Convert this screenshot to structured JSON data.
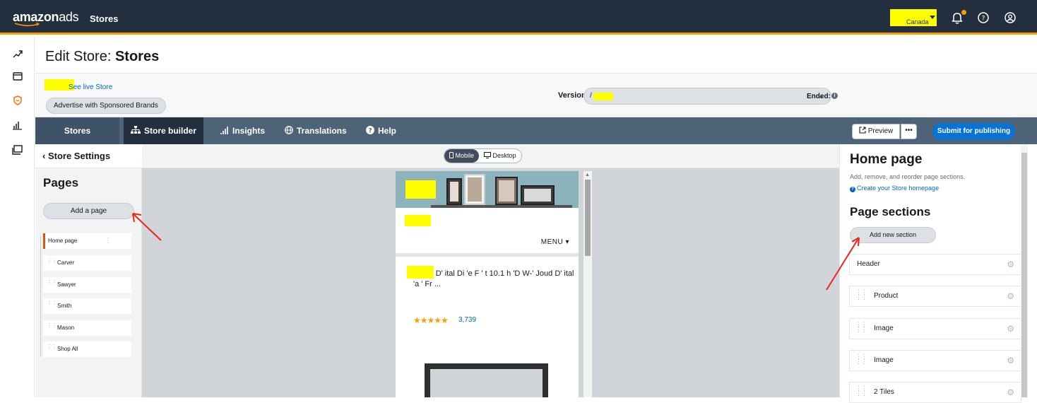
{
  "topbar": {
    "logo_main": "amazon",
    "logo_ads": "ads",
    "title": "Stores",
    "account_country": "Canada",
    "icons": [
      "bell-icon",
      "help-icon",
      "user-icon"
    ]
  },
  "left_rail": {
    "icons": [
      "trend-icon",
      "wallet-icon",
      "shield-icon",
      "bar-chart-icon",
      "media-icon"
    ]
  },
  "page": {
    "title_prefix": "Edit Store:",
    "title_name": "Stores"
  },
  "subbar": {
    "see_live": "See live Store",
    "advertise": "Advertise with Sponsored Brands",
    "version_label": "Version:",
    "version_value": "/",
    "ended_label": "Ended:"
  },
  "nav": {
    "stores": "Stores",
    "items": [
      {
        "label": "Store builder",
        "icon": "sitemap-icon"
      },
      {
        "label": "Insights",
        "icon": "signal-icon"
      },
      {
        "label": "Translations",
        "icon": "globe-icon"
      },
      {
        "label": "Help",
        "icon": "question-icon"
      }
    ],
    "preview": "Preview",
    "more": "•••",
    "submit": "Submit for publishing"
  },
  "left_panel": {
    "back": "Store Settings",
    "heading": "Pages",
    "add_page": "Add a page",
    "pages": [
      "Home page",
      "Carver",
      "Sawyer",
      "Smith",
      "Mason",
      "Shop All"
    ]
  },
  "canvas": {
    "toggle": [
      "Mobile",
      "Desktop"
    ],
    "menu": "MENU",
    "product_title": "C    ' S      ' D' ital Di  'e F '  t 10.1    h 'D W-'   Joud D' ital 'a ' Fr ...",
    "rating_count": "3,739"
  },
  "right_panel": {
    "title": "Home page",
    "description": "Add, remove, and reorder page sections.",
    "link": "Create your Store homepage",
    "sections_heading": "Page sections",
    "add_section": "Add new section",
    "sections": [
      "Header",
      "Product",
      "Image",
      "Image",
      "2 Tiles"
    ]
  },
  "colors": {
    "topbar": "#232f3e",
    "accent_orange": "#ff9900",
    "nav": "#4f6378",
    "primary_blue": "#0972d3",
    "highlight_yellow": "#ffff00",
    "annotation_red": "#e8261c"
  }
}
